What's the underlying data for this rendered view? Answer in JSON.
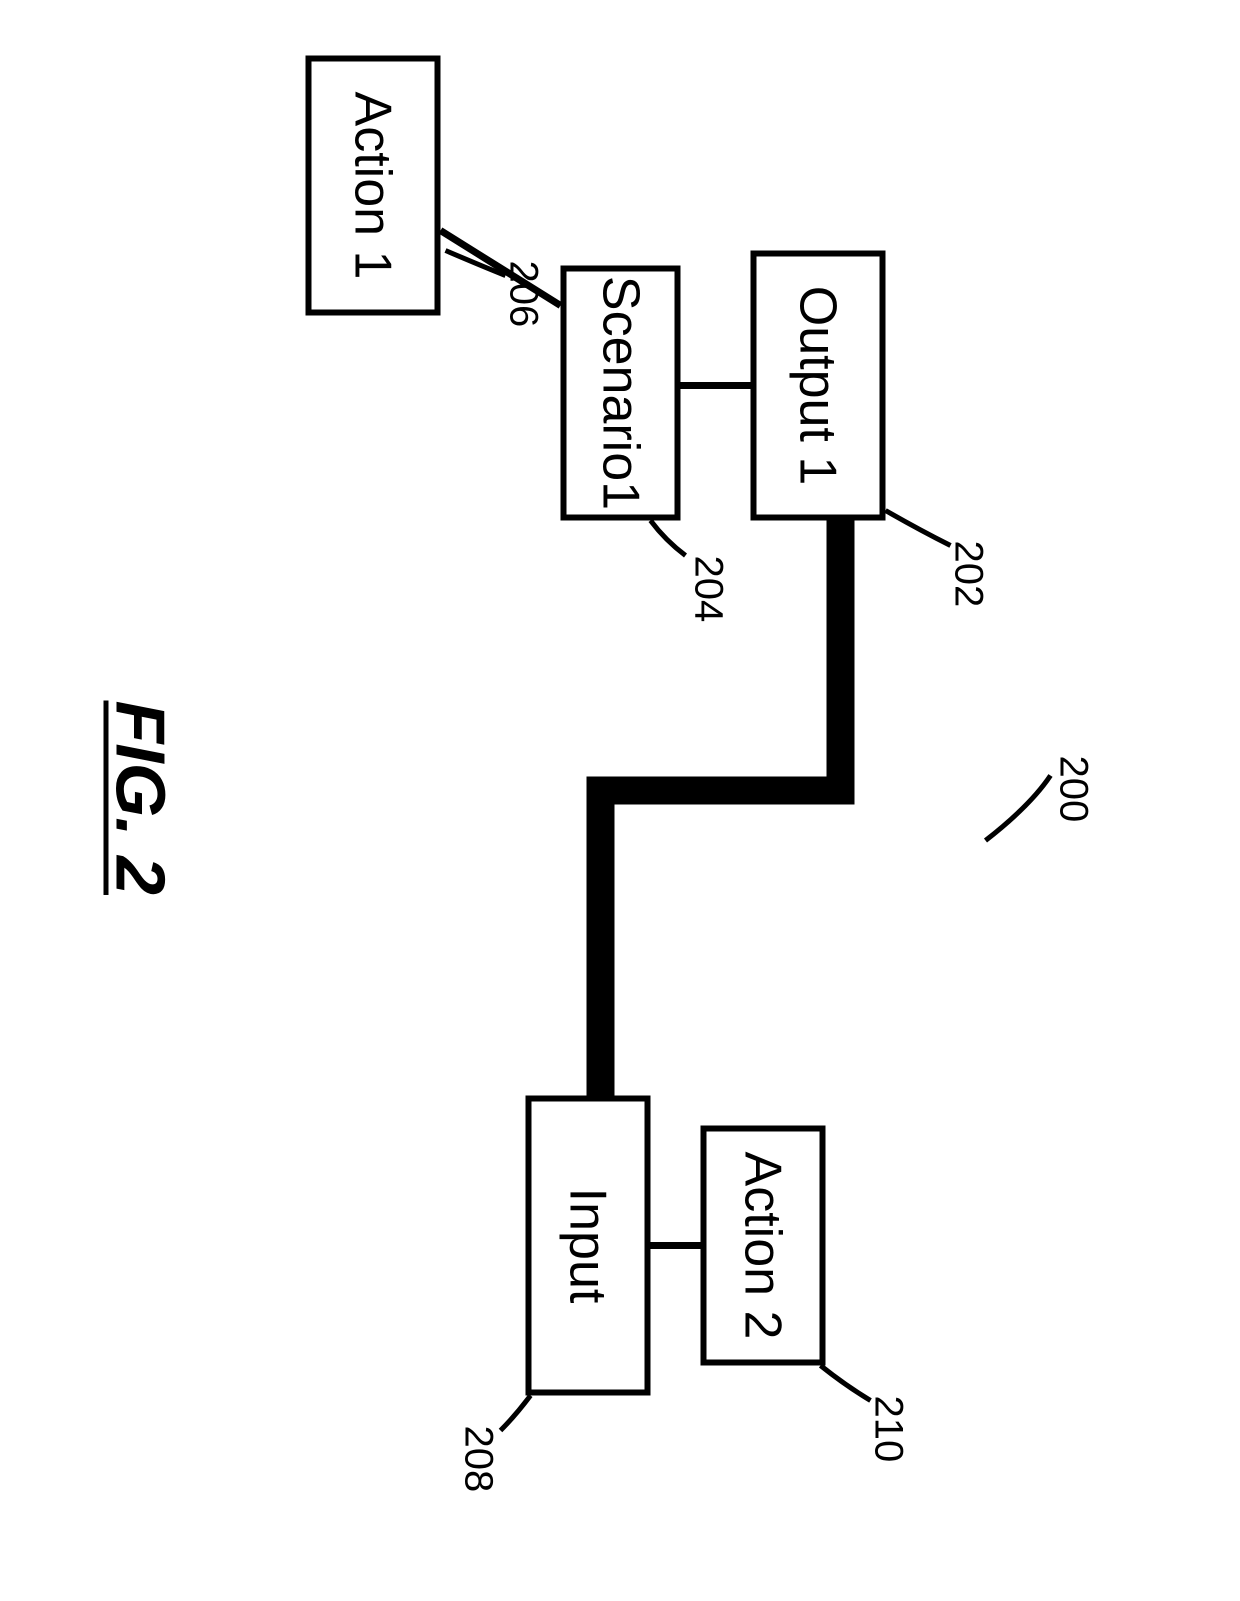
{
  "figure": {
    "caption": "FIG. 2",
    "ref_main": "200"
  },
  "blocks": {
    "output1": {
      "label": "Output 1",
      "ref": "202"
    },
    "scenario1": {
      "label": "Scenario1",
      "ref": "204"
    },
    "action1": {
      "label": "Action 1",
      "ref": "206"
    },
    "input": {
      "label": "Input",
      "ref": "208"
    },
    "action2": {
      "label": "Action 2",
      "ref": "210"
    }
  }
}
